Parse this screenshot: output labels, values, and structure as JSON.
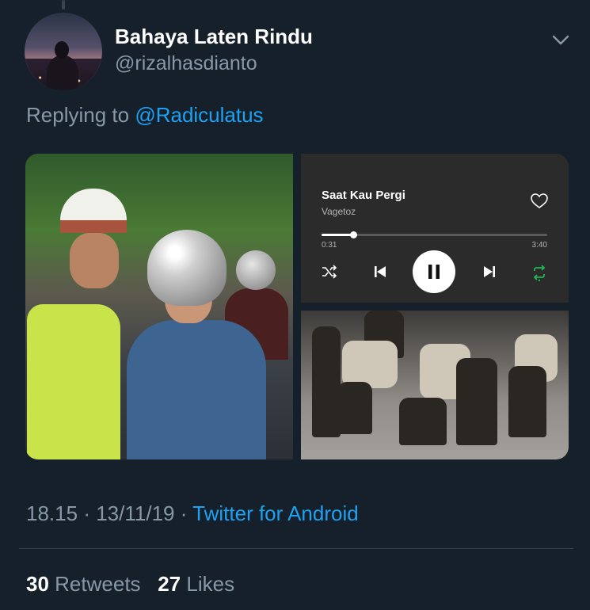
{
  "tweet": {
    "display_name": "Bahaya Laten Rindu",
    "handle": "@rizalhasdianto",
    "replying_prefix": "Replying to",
    "replying_to": "@Radiculatus",
    "time": "18.15",
    "date": "13/11/19",
    "separator": "·",
    "source": "Twitter for Android",
    "retweets_count": "30",
    "retweets_label": "Retweets",
    "likes_count": "27",
    "likes_label": "Likes"
  },
  "player": {
    "song_title": "Saat Kau Pergi",
    "artist": "Vagetoz",
    "elapsed": "0:31",
    "duration": "3:40",
    "progress": 0.14,
    "repeat_color": "#1db954"
  },
  "icons": {
    "caret": "chevron-down-icon",
    "heart": "heart-icon",
    "shuffle": "shuffle-icon",
    "prev": "skip-previous-icon",
    "pause": "pause-icon",
    "next": "skip-next-icon",
    "repeat": "repeat-icon"
  },
  "colors": {
    "background": "#15202b",
    "accent": "#1da1f2",
    "secondary_text": "#8899a6"
  }
}
